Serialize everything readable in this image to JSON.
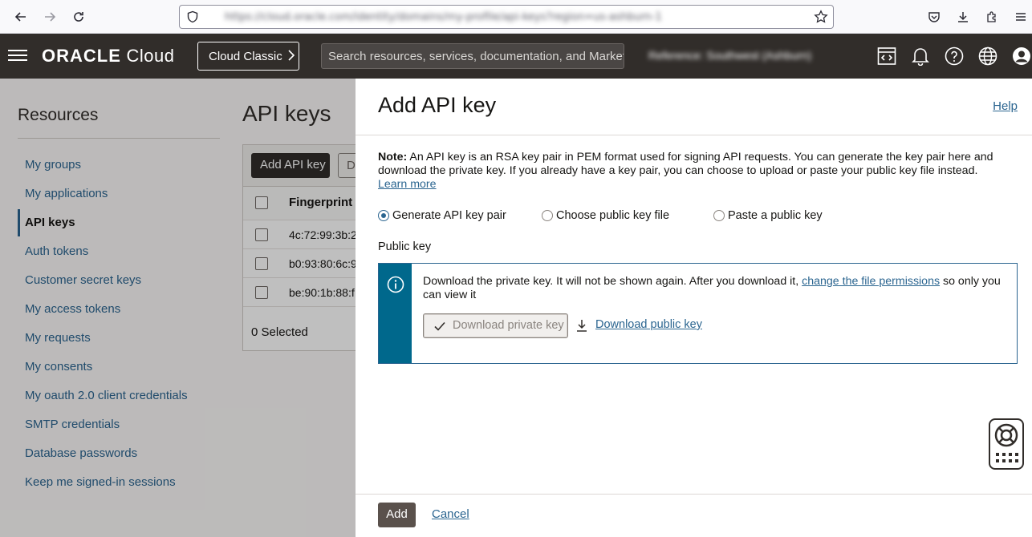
{
  "browser": {
    "url": "https://cloud.oracle.com/identity/domains/my-profile/api-keys?region=us-ashburn-1",
    "icons": [
      "back-icon",
      "forward-icon",
      "reload-icon",
      "shield-icon",
      "star-icon",
      "pocket-icon",
      "download-icon",
      "extensions-icon",
      "menu-icon"
    ]
  },
  "header": {
    "logo_brand": "ORACLE",
    "logo_product": "Cloud",
    "cloud_classic_label": "Cloud Classic",
    "search_placeholder": "Search resources, services, documentation, and Marketplace",
    "tenancy": "Reference: Southwest (Ashburn)",
    "icons": [
      "code-editor-icon",
      "bell-icon",
      "help-icon",
      "globe-icon",
      "user-icon"
    ]
  },
  "sidebar": {
    "title": "Resources",
    "items": [
      {
        "label": "My groups"
      },
      {
        "label": "My applications"
      },
      {
        "label": "API keys",
        "active": true
      },
      {
        "label": "Auth tokens"
      },
      {
        "label": "Customer secret keys"
      },
      {
        "label": "My access tokens"
      },
      {
        "label": "My requests"
      },
      {
        "label": "My consents"
      },
      {
        "label": "My oauth 2.0 client credentials"
      },
      {
        "label": "SMTP credentials"
      },
      {
        "label": "Database passwords"
      },
      {
        "label": "Keep me signed-in sessions"
      }
    ]
  },
  "page": {
    "title": "API keys",
    "add_button": "Add API key",
    "delete_button": "D",
    "table": {
      "header": "Fingerprint",
      "rows": [
        "4c:72:99:3b:2",
        "b0:93:80:6c:9",
        "be:90:1b:88:f"
      ]
    },
    "selected": "0 Selected"
  },
  "panel": {
    "title": "Add API key",
    "help": "Help",
    "note_bold": "Note:",
    "note_text": " An API key is an RSA key pair in PEM format used for signing API requests. You can generate the key pair here and download the private key. If you already have a key pair, you can choose to upload or paste your public key file instead. ",
    "note_link": "Learn more",
    "options": [
      {
        "label": "Generate API key pair",
        "selected": true
      },
      {
        "label": "Choose public key file",
        "selected": false
      },
      {
        "label": "Paste a public key",
        "selected": false
      }
    ],
    "public_key_label": "Public key",
    "info_text_1": "Download the private key. It will not be shown again. After you download it, ",
    "info_link": "change the file permissions",
    "info_text_2": " so only you can view it",
    "download_private": "Download private key",
    "download_public": "Download public key",
    "add_button": "Add",
    "cancel": "Cancel"
  },
  "colors": {
    "header_bg": "#312d2a",
    "link": "#2b6590",
    "info_accent": "#00688c",
    "add_button_bg": "#5a514c"
  }
}
